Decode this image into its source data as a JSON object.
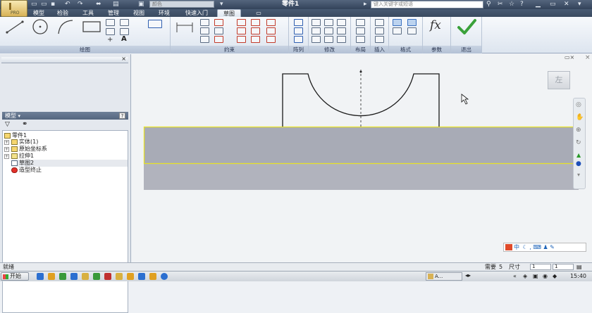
{
  "titlebar": {
    "app_button_pro": "PRO",
    "color_field": "颜色",
    "window_title": "零件1",
    "search_placeholder": "键入关键字或短语"
  },
  "ribbon_tabs": [
    "模型",
    "检验",
    "工具",
    "管理",
    "视图",
    "环境",
    "快速入门",
    "草图"
  ],
  "active_tab": "草图",
  "ribbon_panels": {
    "draw": "绘图",
    "constrain": "约束",
    "pattern": "阵列",
    "modify": "修改",
    "layout": "布局",
    "insert": "插入",
    "format": "格式",
    "parameters": "参数",
    "exit": "退出"
  },
  "ribbon_text_tool": "A",
  "ribbon_fx": "fx",
  "browser": {
    "title": "模型",
    "help": "?",
    "tree": [
      {
        "label": "零件1"
      },
      {
        "label": "实体(1)"
      },
      {
        "label": "原始坐标系"
      },
      {
        "label": "拉伸1"
      },
      {
        "label": "草图2"
      },
      {
        "label": "造型终止"
      }
    ]
  },
  "canvas": {
    "viewcube_label": "左"
  },
  "ime": {
    "label": "中"
  },
  "statusbar": {
    "ready": "就绪",
    "need_label": "需要",
    "need_value": "5",
    "size_label": "尺寸",
    "box1": "1",
    "box2": "1"
  },
  "taskbar": {
    "start": "开始",
    "task_button": "A...",
    "clock": "15:40"
  }
}
